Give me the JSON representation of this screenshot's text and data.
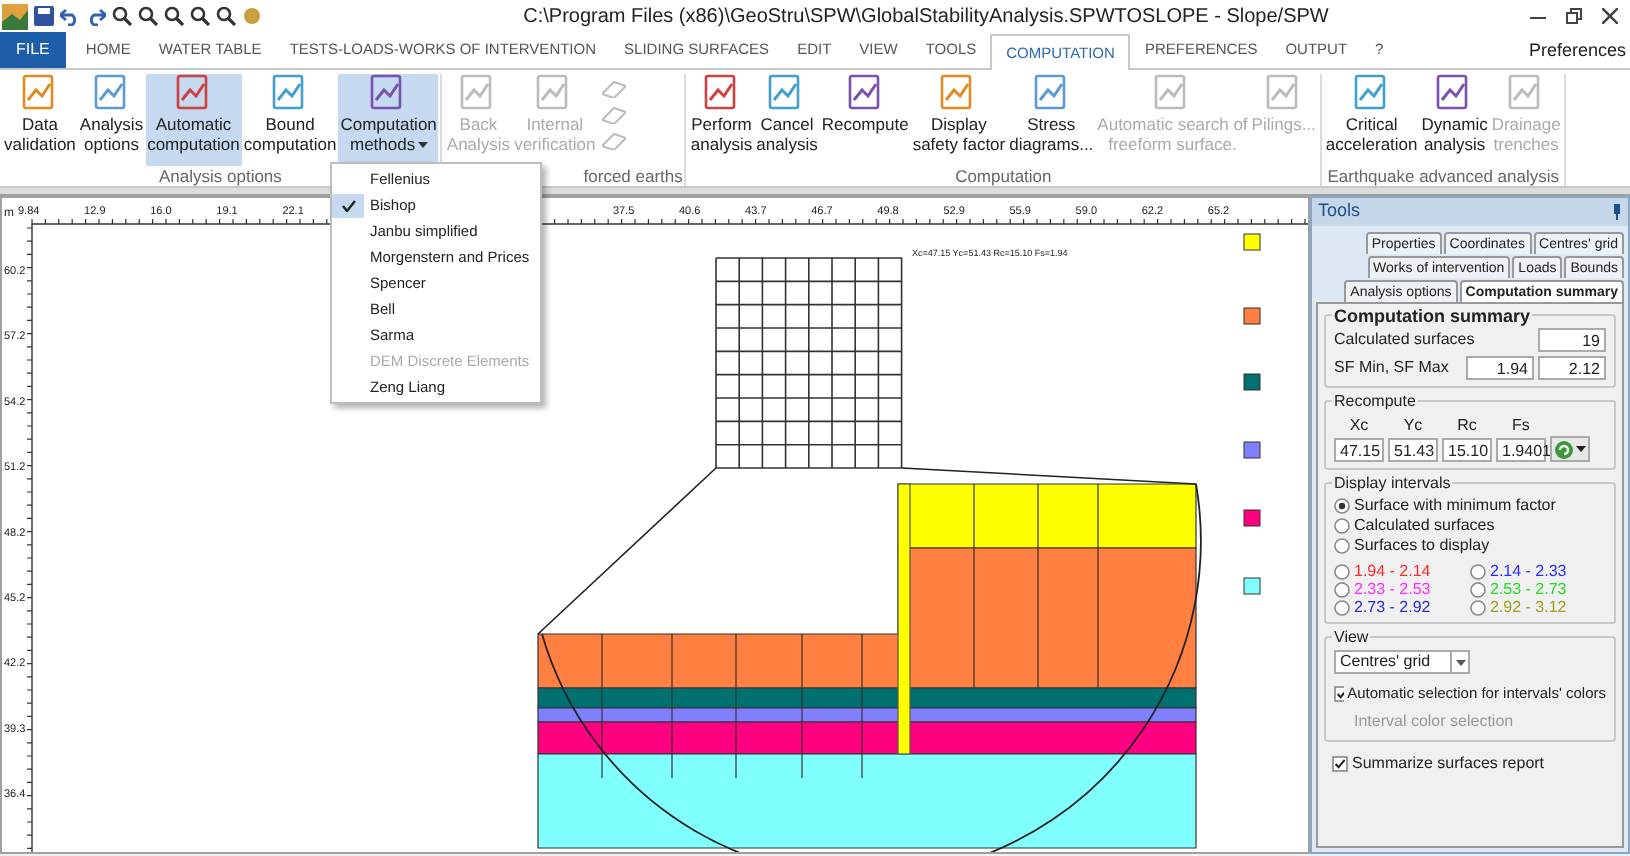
{
  "title_bar": {
    "title": "C:\\Program Files (x86)\\GeoStru\\SPW\\GlobalStabilityAnalysis.SPWTOSLOPE - Slope/SPW"
  },
  "tabs": [
    {
      "label": "FILE",
      "kind": "file",
      "selected": false
    },
    {
      "label": "HOME",
      "kind": "tab",
      "selected": false
    },
    {
      "label": "WATER TABLE",
      "kind": "tab",
      "selected": false
    },
    {
      "label": "TESTS-LOADS-WORKS OF INTERVENTION",
      "kind": "tab",
      "selected": false
    },
    {
      "label": "SLIDING SURFACES",
      "kind": "tab",
      "selected": false
    },
    {
      "label": "EDIT",
      "kind": "tab",
      "selected": false
    },
    {
      "label": "VIEW",
      "kind": "tab",
      "selected": false
    },
    {
      "label": "TOOLS",
      "kind": "tab",
      "selected": false
    },
    {
      "label": "COMPUTATION",
      "kind": "tab",
      "selected": true
    },
    {
      "label": "PREFERENCES",
      "kind": "tab",
      "selected": false
    },
    {
      "label": "OUTPUT",
      "kind": "tab",
      "selected": false
    },
    {
      "label": "?",
      "kind": "tab",
      "selected": false
    }
  ],
  "preferences_link": "Preferences",
  "ribbon_groups": [
    {
      "label": "Analysis options",
      "kind": "normal",
      "buttons": [
        {
          "label": "Data\nvalidation",
          "kind": "large",
          "disabled": false,
          "selected": false
        },
        {
          "label": "Analysis\noptions",
          "kind": "large",
          "disabled": false,
          "selected": false
        },
        {
          "label": "Automatic\ncomputation",
          "kind": "large",
          "disabled": false,
          "selected": true
        },
        {
          "label": "Bound\ncomputation",
          "kind": "large",
          "disabled": false,
          "selected": false
        },
        {
          "label": "Computation\nmethods",
          "kind": "dropdown",
          "disabled": false,
          "selected": true
        }
      ]
    },
    {
      "label": "forced earths",
      "kind": "covered",
      "buttons": [
        {
          "label": "Back\nAnalysis",
          "kind": "large",
          "disabled": true,
          "selected": false
        },
        {
          "label": "Internal\nverification",
          "kind": "large",
          "disabled": true,
          "selected": false
        },
        {
          "kind": "small-stack",
          "disabled": true
        }
      ]
    },
    {
      "label": "Computation",
      "kind": "normal",
      "buttons": [
        {
          "label": "Perform\nanalysis",
          "kind": "large",
          "disabled": false,
          "selected": false
        },
        {
          "label": "Cancel\nanalysis",
          "kind": "large",
          "disabled": false,
          "selected": false
        },
        {
          "label": "Recompute",
          "kind": "large",
          "disabled": false,
          "selected": false
        },
        {
          "label": "Display\nsafety factor",
          "kind": "large",
          "disabled": false,
          "selected": false
        },
        {
          "label": "Stress\ndiagrams...",
          "kind": "large",
          "disabled": false,
          "selected": false
        },
        {
          "label": "Automatic search of\nfreeform surface.",
          "kind": "large",
          "disabled": true,
          "selected": false
        },
        {
          "label": "Pilings...",
          "kind": "large",
          "disabled": true,
          "selected": false
        }
      ]
    },
    {
      "label": "Earthquake advanced analysis",
      "kind": "normal",
      "buttons": [
        {
          "label": "Critical\nacceleration",
          "kind": "large",
          "disabled": false,
          "selected": false
        },
        {
          "label": "Dynamic\nanalysis",
          "kind": "large",
          "disabled": false,
          "selected": false
        },
        {
          "label": "Drainage\ntrenches",
          "kind": "large",
          "disabled": true,
          "selected": false
        }
      ]
    }
  ],
  "methods_menu": [
    {
      "label": "Fellenius",
      "checked": false,
      "disabled": false
    },
    {
      "label": "Bishop",
      "checked": true,
      "disabled": false
    },
    {
      "label": "Janbu simplified",
      "checked": false,
      "disabled": false
    },
    {
      "label": "Morgenstern and Prices",
      "checked": false,
      "disabled": false
    },
    {
      "label": "Spencer",
      "checked": false,
      "disabled": false
    },
    {
      "label": "Bell",
      "checked": false,
      "disabled": false
    },
    {
      "label": "Sarma",
      "checked": false,
      "disabled": false
    },
    {
      "label": "DEM Discrete Elements",
      "checked": false,
      "disabled": true
    },
    {
      "label": "Zeng Liang",
      "checked": false,
      "disabled": false
    }
  ],
  "canvas": {
    "unit": "m",
    "x_ruler": [
      [
        "9.84",
        "12.9",
        "16.0",
        "19.1",
        "22.1"
      ],
      [
        "37.5",
        "40.6",
        "43.7",
        "46.7",
        "49.8",
        "52.9",
        "55.9",
        "59.0",
        "62.2",
        "65.2"
      ]
    ],
    "y_ruler": [
      "60.2",
      "57.2",
      "54.2",
      "51.2",
      "48.2",
      "45.2",
      "42.2",
      "39.3",
      "36.4"
    ],
    "surface_label": "Xc=47.15 Yc=51.43 Rc=15.10 Fs=1.94",
    "layers": [
      {
        "color": "#ffff00"
      },
      {
        "color": "#ff8040"
      },
      {
        "color": "#007070"
      },
      {
        "color": "#8080ff"
      },
      {
        "color": "#ff0080"
      },
      {
        "color": "#80ffff"
      }
    ]
  },
  "tools_panel": {
    "title": "Tools",
    "tab_rows": [
      [
        {
          "label": "Properties",
          "selected": false
        },
        {
          "label": "Coordinates",
          "selected": false
        },
        {
          "label": "Centres' grid",
          "selected": false
        }
      ],
      [
        {
          "label": "Works of intervention",
          "selected": false
        },
        {
          "label": "Loads",
          "selected": false
        },
        {
          "label": "Bounds",
          "selected": false
        }
      ],
      [
        {
          "label": "Analysis options",
          "selected": false
        },
        {
          "label": "Computation summary",
          "selected": true
        }
      ]
    ],
    "summary": {
      "title": "Computation summary",
      "calculated_label": "Calculated surfaces",
      "calculated_value": "19",
      "sf_label": "SF Min, SF Max",
      "sf_min": "1.94",
      "sf_max": "2.12"
    },
    "recompute": {
      "title": "Recompute",
      "fields": [
        {
          "label": "Xc",
          "value": "47.15"
        },
        {
          "label": "Yc",
          "value": "51.43"
        },
        {
          "label": "Rc",
          "value": "15.10"
        },
        {
          "label": "Fs",
          "value": "1.9401"
        }
      ]
    },
    "display_intervals": {
      "title": "Display intervals",
      "options": [
        {
          "label": "Surface with minimum factor",
          "selected": true
        },
        {
          "label": "Calculated surfaces",
          "selected": false
        },
        {
          "label": "Surfaces to display",
          "selected": false
        }
      ],
      "intervals": [
        {
          "label": "1.94 - 2.14",
          "color": "#ff2a2a",
          "selected": false
        },
        {
          "label": "2.14 - 2.33",
          "color": "#2a2aff",
          "selected": false
        },
        {
          "label": "2.33 - 2.53",
          "color": "#ff2aff",
          "selected": false
        },
        {
          "label": "2.53 - 2.73",
          "color": "#22dd22",
          "selected": false
        },
        {
          "label": "2.73 - 2.92",
          "color": "#2a2acc",
          "selected": false
        },
        {
          "label": "2.92 - 3.12",
          "color": "#a0a020",
          "selected": false
        }
      ]
    },
    "view": {
      "title": "View",
      "select_value": "Centres' grid",
      "auto_color": {
        "label": "Automatic selection for intervals' colors",
        "checked": true
      },
      "interval_color_link": {
        "label": "Interval color selection",
        "disabled": true
      }
    },
    "summarize": {
      "label": "Summarize surfaces report",
      "checked": true
    }
  }
}
